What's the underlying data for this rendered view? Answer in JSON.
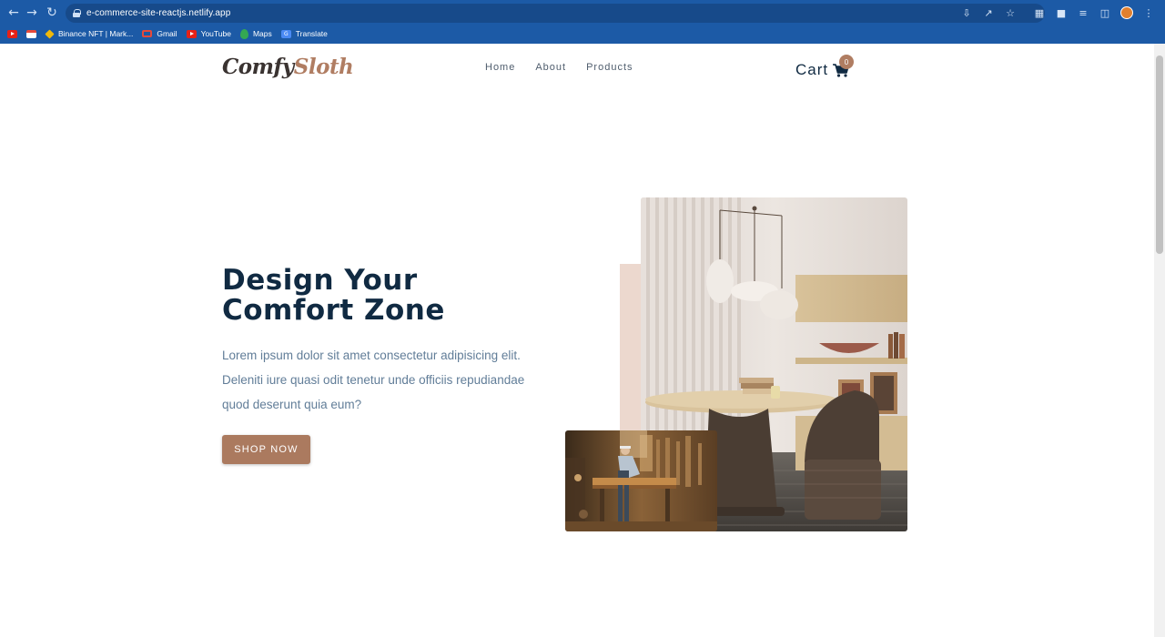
{
  "browser": {
    "url": "e-commerce-site-reactjs.netlify.app",
    "bookmarks": [
      {
        "label": "",
        "icon": "youtube-icon"
      },
      {
        "label": "",
        "icon": "calendar-icon"
      },
      {
        "label": "Binance NFT | Mark...",
        "icon": "binance-icon"
      },
      {
        "label": "Gmail",
        "icon": "gmail-icon"
      },
      {
        "label": "YouTube",
        "icon": "youtube-icon"
      },
      {
        "label": "Maps",
        "icon": "maps-icon"
      },
      {
        "label": "Translate",
        "icon": "translate-icon"
      }
    ]
  },
  "site": {
    "logo_part1": "Comfy",
    "logo_part2": "Sloth",
    "nav": [
      "Home",
      "About",
      "Products"
    ],
    "cart_label": "Cart",
    "cart_count": "0"
  },
  "hero": {
    "title_line1": "Design Your",
    "title_line2": "Comfort Zone",
    "text": "Lorem ipsum dolor sit amet consectetur adipisicing elit. Deleniti iure quasi odit tenetur unde officiis repudiandae quod deserunt quia eum?",
    "button": "SHOP NOW"
  },
  "colors": {
    "chrome": "#1c5aa6",
    "primary": "#ab7a5f",
    "heading": "#102a42",
    "body_text": "#617d98",
    "accent_light": "#ecd8ce"
  }
}
